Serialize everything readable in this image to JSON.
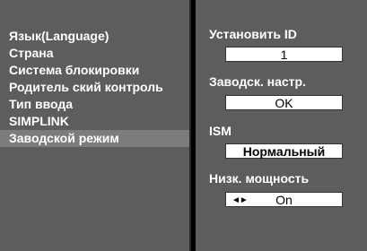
{
  "menu": {
    "items": [
      {
        "label": "Язык(Language)"
      },
      {
        "label": "Страна"
      },
      {
        "label": "Система блокировки"
      },
      {
        "label": "Родитель ский контроль"
      },
      {
        "label": "Тип ввода"
      },
      {
        "label": "SIMPLINK"
      },
      {
        "label": "Заводской режим"
      }
    ],
    "selected": "Заводской режим"
  },
  "settings": {
    "set_id_label": "Установить ID",
    "set_id_value": "1",
    "factory_reset_label": "Заводск. настр.",
    "factory_reset_button": "OK",
    "ism_label": "ISM",
    "ism_value": "Нормальный",
    "low_power_label": "Низк. мощность",
    "low_power_arrows": "◄►",
    "low_power_value": "On"
  }
}
